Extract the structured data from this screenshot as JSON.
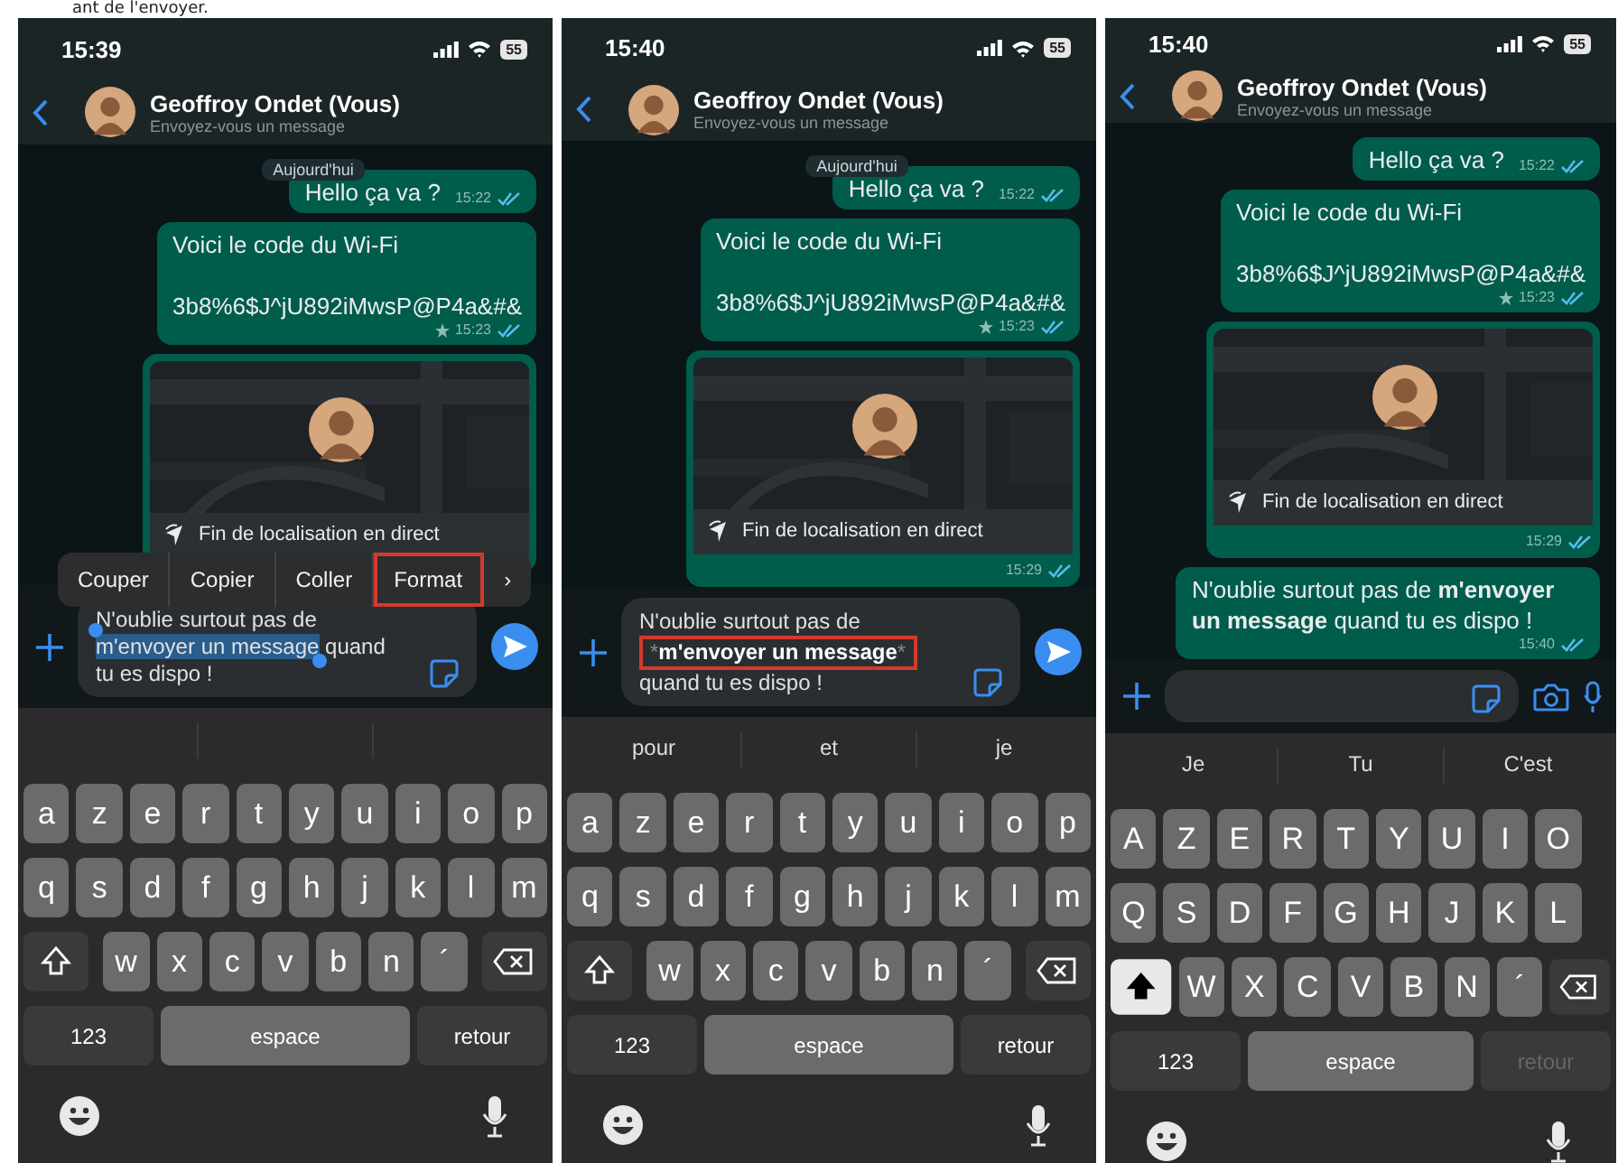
{
  "caption": "ant de l'envoyer.",
  "phones": [
    {
      "status": {
        "time": "15:39",
        "battery": "55"
      },
      "header": {
        "name": "Geoffroy Ondet (Vous)",
        "subtitle": "Envoyez-vous un message"
      },
      "date_chip": "Aujourd'hui",
      "messages": [
        {
          "kind": "text",
          "text": "Hello ça va ?",
          "time": "15:22",
          "starred": false,
          "read": true
        },
        {
          "kind": "text",
          "text": "Voici le code du Wi-Fi\n\n3b8%6$J^jU892iMwsP@P4a&#&",
          "time": "15:23",
          "starred": true,
          "read": true
        },
        {
          "kind": "location",
          "text": "Fin de localisation en direct"
        }
      ],
      "edit_menu": {
        "items": [
          {
            "label": "Couper",
            "highlighted": false
          },
          {
            "label": "Copier",
            "highlighted": false
          },
          {
            "label": "Coller",
            "highlighted": false
          },
          {
            "label": "Format",
            "highlighted": true
          }
        ],
        "more": "›"
      },
      "composer": {
        "empty": false,
        "lines": [
          {
            "framed": false,
            "segments": [
              {
                "kind": "plain",
                "text": "N'oublie surtout pas de"
              }
            ]
          },
          {
            "framed": false,
            "segments": [
              {
                "kind": "selected",
                "text": "m'envoyer un message"
              },
              {
                "kind": "plain",
                "text": " quand"
              }
            ]
          },
          {
            "framed": false,
            "segments": [
              {
                "kind": "plain",
                "text": "tu es dispo !"
              }
            ]
          }
        ]
      },
      "keyboard": {
        "shift_on": false,
        "rows": [
          [
            "a",
            "z",
            "e",
            "r",
            "t",
            "y",
            "u",
            "i",
            "o",
            "p"
          ],
          [
            "q",
            "s",
            "d",
            "f",
            "g",
            "h",
            "j",
            "k",
            "l",
            "m"
          ],
          [
            "w",
            "x",
            "c",
            "v",
            "b",
            "n",
            "´"
          ]
        ],
        "numbers": "123",
        "space": "espace",
        "return": "retour",
        "return_disabled": false
      }
    },
    {
      "status": {
        "time": "15:40",
        "battery": "55"
      },
      "header": {
        "name": "Geoffroy Ondet (Vous)",
        "subtitle": "Envoyez-vous un message"
      },
      "date_chip": "Aujourd'hui",
      "messages": [
        {
          "kind": "text",
          "text": "Hello ça va ?",
          "time": "15:22",
          "starred": false,
          "read": true
        },
        {
          "kind": "text",
          "text": "Voici le code du Wi-Fi\n\n3b8%6$J^jU892iMwsP@P4a&#&",
          "time": "15:23",
          "starred": true,
          "read": true
        },
        {
          "kind": "location",
          "text": "Fin de localisation en direct",
          "time": "15:29",
          "starred": false,
          "read": true
        }
      ],
      "composer": {
        "empty": false,
        "lines": [
          {
            "framed": false,
            "segments": [
              {
                "kind": "plain",
                "text": "N'oublie surtout pas de"
              }
            ]
          },
          {
            "framed": true,
            "segments": [
              {
                "kind": "marker",
                "text": "*"
              },
              {
                "kind": "bold",
                "text": "m'envoyer un message"
              },
              {
                "kind": "marker",
                "text": "*"
              }
            ]
          },
          {
            "framed": false,
            "segments": [
              {
                "kind": "plain",
                "text": "quand tu es dispo !"
              }
            ]
          }
        ]
      },
      "suggestions": [
        "pour",
        "et",
        "je"
      ],
      "keyboard": {
        "shift_on": false,
        "rows": [
          [
            "a",
            "z",
            "e",
            "r",
            "t",
            "y",
            "u",
            "i",
            "o",
            "p"
          ],
          [
            "q",
            "s",
            "d",
            "f",
            "g",
            "h",
            "j",
            "k",
            "l",
            "m"
          ],
          [
            "w",
            "x",
            "c",
            "v",
            "b",
            "n",
            "´"
          ]
        ],
        "numbers": "123",
        "space": "espace",
        "return": "retour",
        "return_disabled": false
      }
    },
    {
      "status": {
        "time": "15:40",
        "battery": "55"
      },
      "header": {
        "name": "Geoffroy Ondet (Vous)",
        "subtitle": "Envoyez-vous un message"
      },
      "messages": [
        {
          "kind": "text",
          "text": "Hello ça va ?",
          "time": "15:22",
          "starred": false,
          "read": true
        },
        {
          "kind": "text",
          "text": "Voici le code du Wi-Fi\n\n3b8%6$J^jU892iMwsP@P4a&#&",
          "time": "15:23",
          "starred": true,
          "read": true
        },
        {
          "kind": "location",
          "text": "Fin de localisation en direct",
          "time": "15:29",
          "starred": false,
          "read": true
        },
        {
          "kind": "text",
          "text": "N'oublie surtout pas de **m'envoyer un message** quand tu es dispo !",
          "time": "15:40",
          "starred": false,
          "read": true
        }
      ],
      "composer": {
        "empty": true
      },
      "suggestions": [
        "Je",
        "Tu",
        "C'est"
      ],
      "keyboard": {
        "shift_on": true,
        "rows": [
          [
            "A",
            "Z",
            "E",
            "R",
            "T",
            "Y",
            "U",
            "I",
            "O"
          ],
          [
            "Q",
            "S",
            "D",
            "F",
            "G",
            "H",
            "J",
            "K",
            "L"
          ],
          [
            "W",
            "X",
            "C",
            "V",
            "B",
            "N",
            "´"
          ]
        ],
        "numbers": "123",
        "space": "espace",
        "return": "retour",
        "return_disabled": true
      }
    }
  ]
}
